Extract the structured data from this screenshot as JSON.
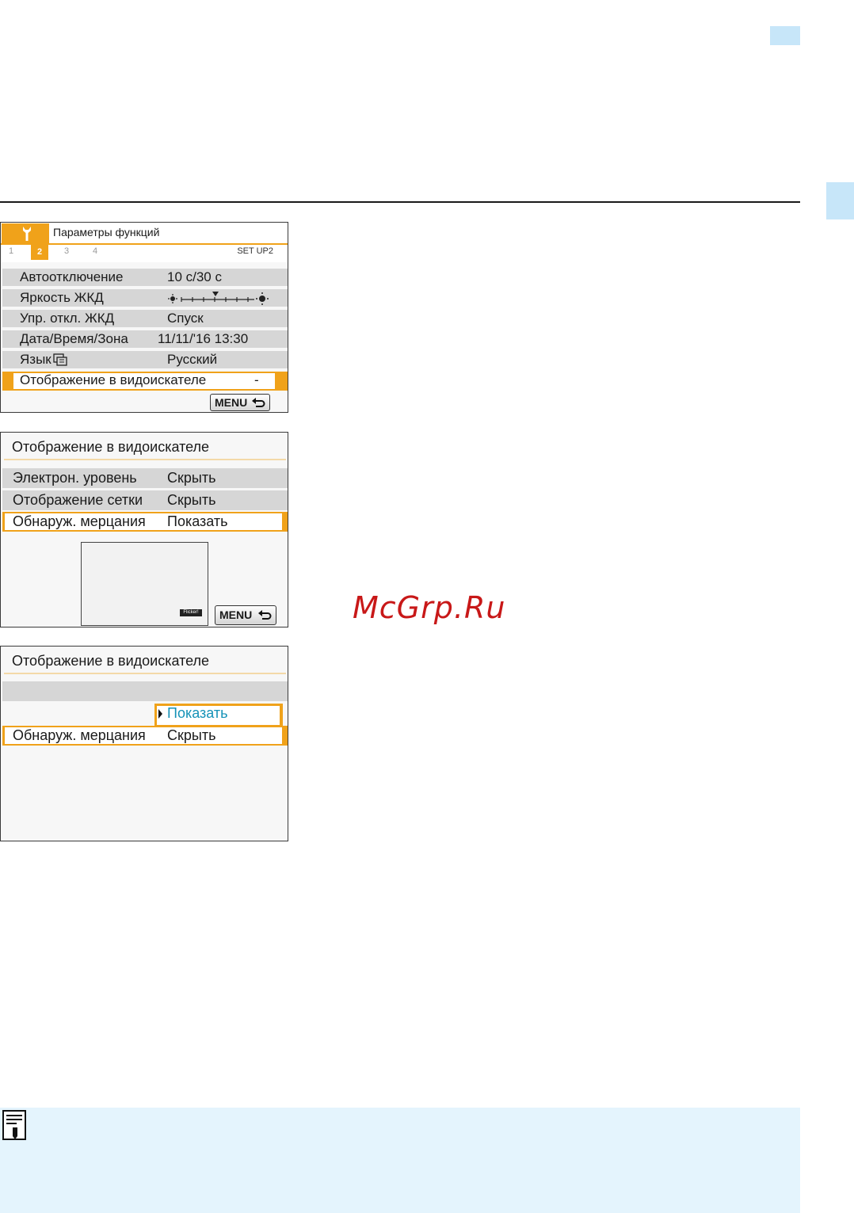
{
  "screen1": {
    "title": "Параметры функций",
    "tabs": [
      "1",
      "2",
      "3",
      "4"
    ],
    "active_tab": "2",
    "tab_code": "SET UP2",
    "rows": [
      {
        "label": "Автоотключение",
        "value": "10 с/30 с"
      },
      {
        "label": "Яркость ЖКД",
        "value": ""
      },
      {
        "label": "Упр. откл. ЖКД",
        "value": "Спуск"
      },
      {
        "label": "Дата/Время/Зона",
        "value": "11/11/'16 13:30"
      },
      {
        "label": "Язык",
        "value": "Русский"
      },
      {
        "label": "Отображение в видоискателе",
        "value": "-"
      }
    ],
    "menu_label": "MENU"
  },
  "screen2": {
    "title": "Отображение в видоискателе",
    "rows": [
      {
        "label": "Электрон. уровень",
        "value": "Скрыть"
      },
      {
        "label": "Отображение сетки",
        "value": "Скрыть"
      },
      {
        "label": "Обнаруж. мерцания",
        "value": "Показать"
      }
    ],
    "flicker_icon_label": "Flicker!",
    "menu_label": "MENU"
  },
  "screen3": {
    "title": "Отображение в видоискателе",
    "option": "Показать",
    "row": {
      "label": "Обнаруж. мерцания",
      "value": "Скрыть"
    }
  },
  "watermark": "McGrp.Ru",
  "colors": {
    "accent": "#f0a21a",
    "tab_blue": "#c7e6f9",
    "note_bg": "#e4f4fd",
    "option_blue": "#1592b7"
  }
}
